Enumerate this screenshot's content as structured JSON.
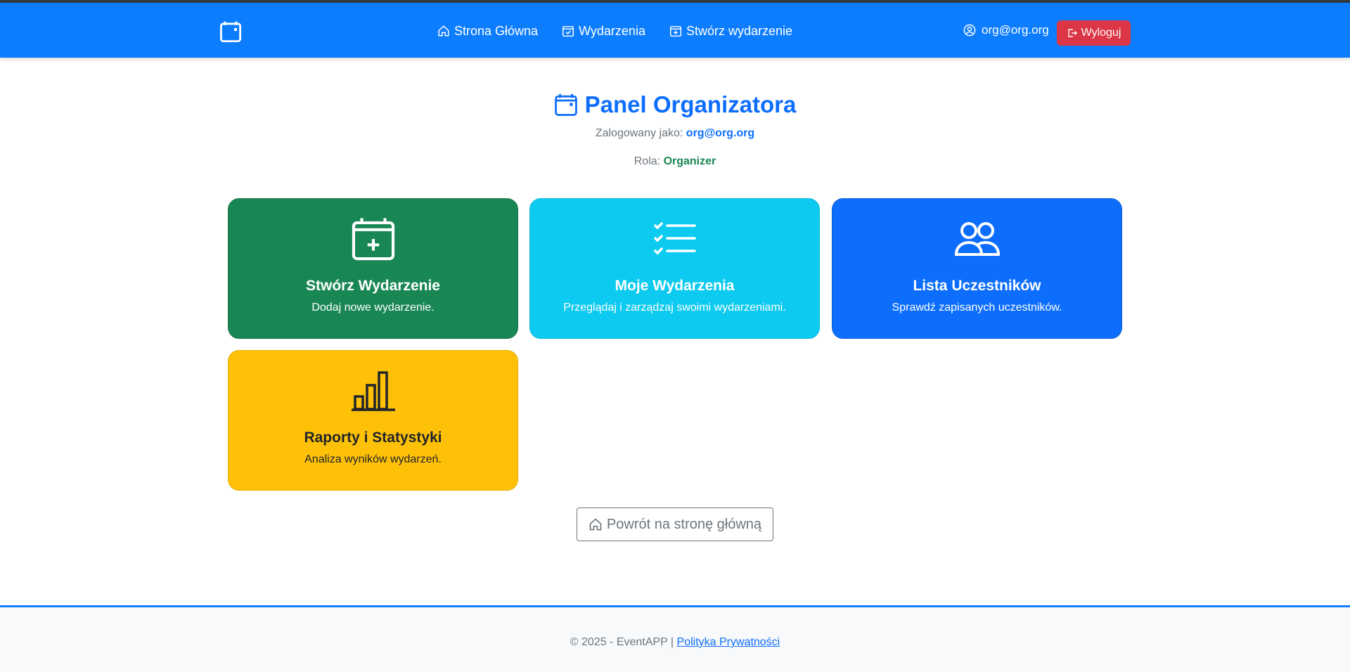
{
  "navbar": {
    "brand_icon": "calendar-icon",
    "links": [
      {
        "label": "Strona Główna",
        "icon": "house-icon"
      },
      {
        "label": "Wydarzenia",
        "icon": "calendar-check-icon"
      },
      {
        "label": "Stwórz wydarzenie",
        "icon": "calendar-plus-icon"
      }
    ],
    "user_email": "org@org.org",
    "logout_label": "Wyloguj",
    "color": "#0d7dff"
  },
  "header": {
    "title": "Panel Organizatora",
    "logged_as_label": "Zalogowany jako:",
    "logged_as_value": "org@org.org",
    "role_label": "Rola:",
    "role_value": "Organizer"
  },
  "cards": [
    {
      "title": "Stwórz Wydarzenie",
      "desc": "Dodaj nowe wydarzenie.",
      "icon": "calendar-plus-icon",
      "color": "#198754"
    },
    {
      "title": "Moje Wydarzenia",
      "desc": "Przeglądaj i zarządzaj swoimi wydarzeniami.",
      "icon": "list-check-icon",
      "color": "#0dcaf0"
    },
    {
      "title": "Lista Uczestników",
      "desc": "Sprawdź zapisanych uczestników.",
      "icon": "people-icon",
      "color": "#0d6efd"
    },
    {
      "title": "Raporty i Statystyki",
      "desc": "Analiza wyników wydarzeń.",
      "icon": "bar-chart-icon",
      "color": "#ffc107"
    }
  ],
  "back_button": {
    "label": "Powrót na stronę główną",
    "icon": "house-icon"
  },
  "footer": {
    "copyright": "© 2025 - EventAPP |",
    "privacy_link": "Polityka Prywatności"
  }
}
